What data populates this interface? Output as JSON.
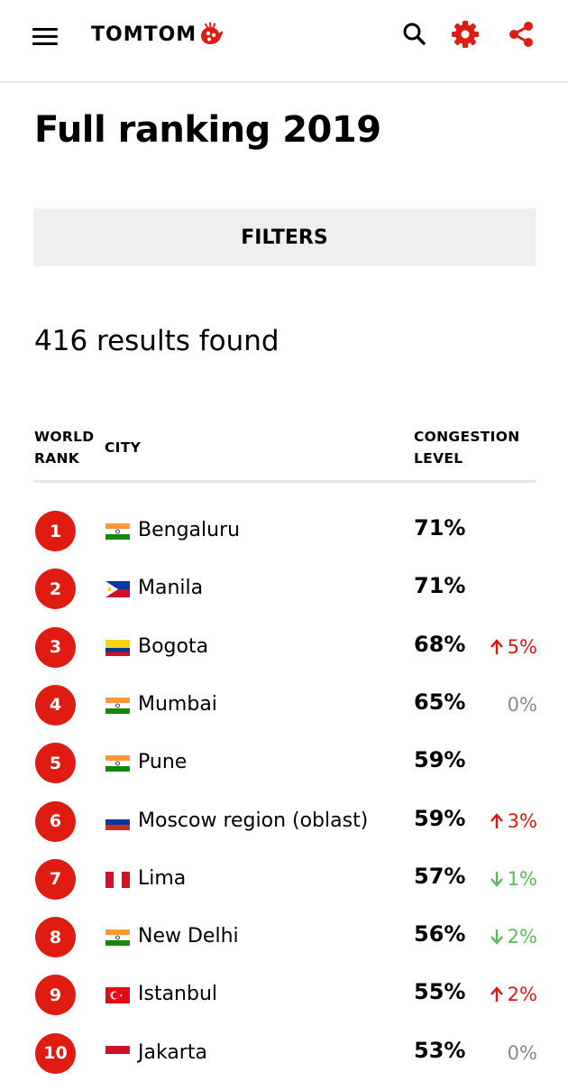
{
  "header": {
    "logo_text": "TOMTOM",
    "icons": [
      "menu-icon",
      "search-icon",
      "gear-icon",
      "share-icon"
    ],
    "accent_color": "#df1b12"
  },
  "page": {
    "title": "Full ranking 2019",
    "filters_label": "FILTERS",
    "results_text": "416 results found"
  },
  "table": {
    "col_rank_line1": "WORLD",
    "col_rank_line2": "RANK",
    "col_city": "CITY",
    "col_cong_line1": "CONGESTION",
    "col_cong_line2": "LEVEL",
    "rows": [
      {
        "rank": "1",
        "city": "Bengaluru",
        "country": "india",
        "level": "71%",
        "change": "",
        "dir": "none"
      },
      {
        "rank": "2",
        "city": "Manila",
        "country": "philippines",
        "level": "71%",
        "change": "",
        "dir": "none"
      },
      {
        "rank": "3",
        "city": "Bogota",
        "country": "colombia",
        "level": "68%",
        "change": "5%",
        "dir": "up"
      },
      {
        "rank": "4",
        "city": "Mumbai",
        "country": "india",
        "level": "65%",
        "change": "0%",
        "dir": "flat"
      },
      {
        "rank": "5",
        "city": "Pune",
        "country": "india",
        "level": "59%",
        "change": "",
        "dir": "none"
      },
      {
        "rank": "6",
        "city": "Moscow region (oblast)",
        "country": "russia",
        "level": "59%",
        "change": "3%",
        "dir": "up"
      },
      {
        "rank": "7",
        "city": "Lima",
        "country": "peru",
        "level": "57%",
        "change": "1%",
        "dir": "down"
      },
      {
        "rank": "8",
        "city": "New Delhi",
        "country": "india",
        "level": "56%",
        "change": "2%",
        "dir": "down"
      },
      {
        "rank": "9",
        "city": "Istanbul",
        "country": "turkey",
        "level": "55%",
        "change": "2%",
        "dir": "up"
      },
      {
        "rank": "10",
        "city": "Jakarta",
        "country": "indonesia",
        "level": "53%",
        "change": "0%",
        "dir": "flat"
      }
    ]
  }
}
